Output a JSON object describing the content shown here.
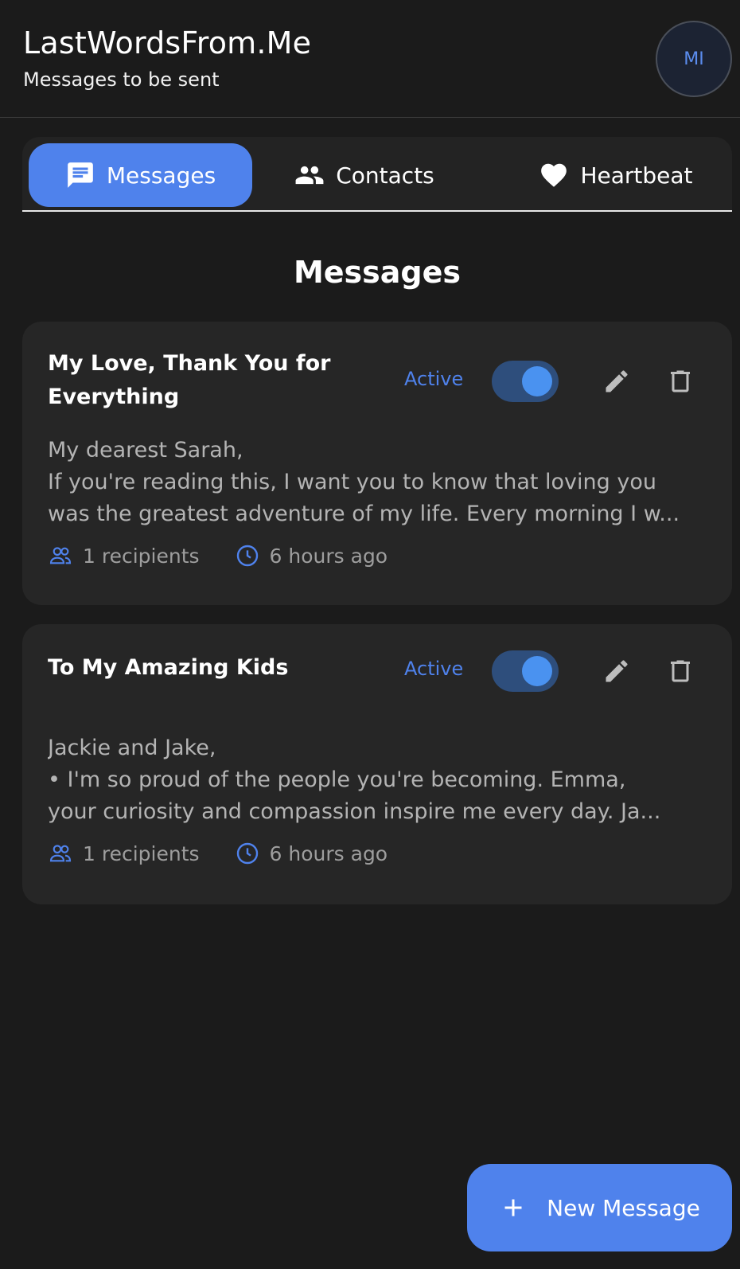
{
  "header": {
    "title": "LastWordsFrom.Me",
    "subtitle": "Messages to be sent",
    "avatar_initials": "MI"
  },
  "tabs": [
    {
      "label": "Messages",
      "icon": "chat-icon",
      "active": true
    },
    {
      "label": "Contacts",
      "icon": "people-icon",
      "active": false
    },
    {
      "label": "Heartbeat",
      "icon": "heart-icon",
      "active": false
    }
  ],
  "section_title": "Messages",
  "messages": [
    {
      "title": "My Love, Thank You for Everything",
      "status": "Active",
      "enabled": true,
      "body_lines": [
        "My dearest Sarah,",
        "If you're reading this, I want you to know that loving you",
        "was the greatest adventure of my life. Every morning I w..."
      ],
      "recipients": "1 recipients",
      "time": "6 hours ago"
    },
    {
      "title": "To My Amazing Kids",
      "status": "Active",
      "enabled": true,
      "body_lines": [
        "Jackie and Jake,",
        "• I'm so proud of the people you're becoming. Emma,",
        "your curiosity and compassion inspire me every day. Ja..."
      ],
      "recipients": "1 recipients",
      "time": "6 hours ago"
    }
  ],
  "fab": {
    "label": "New Message",
    "icon": "plus-icon"
  },
  "colors": {
    "accent": "#4f82ec",
    "background": "#1b1b1b",
    "card": "#262626",
    "toggle_track": "#2e4e7c",
    "toggle_knob": "#4a92f0"
  }
}
